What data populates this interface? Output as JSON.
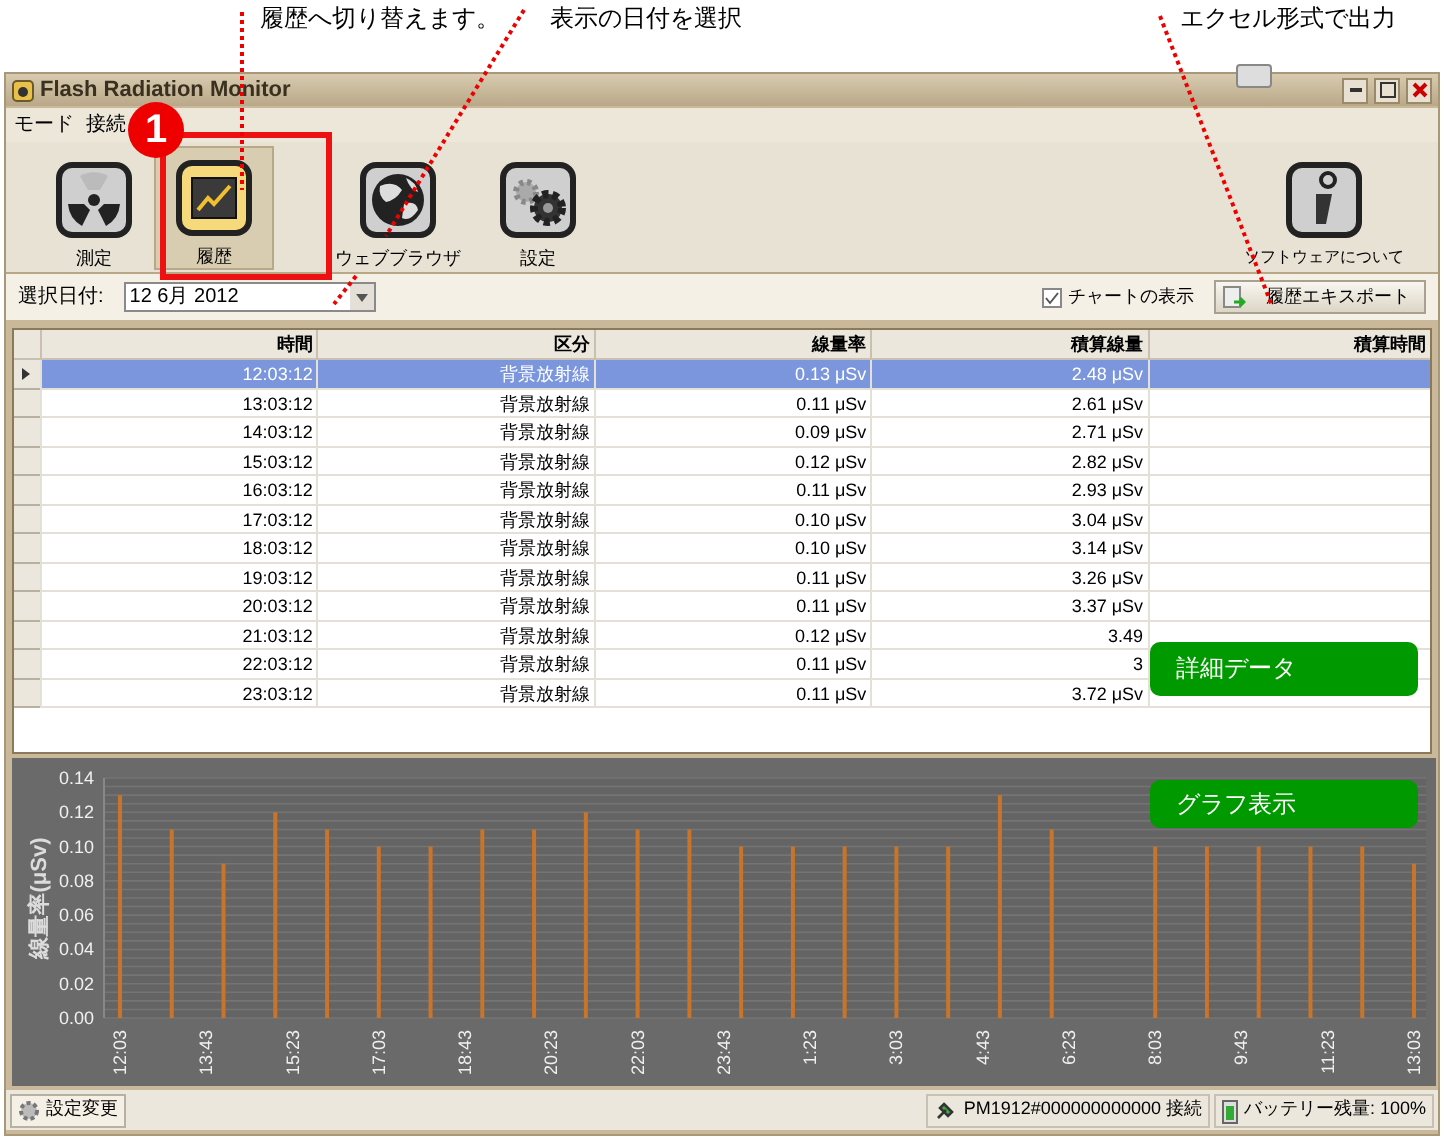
{
  "annotations": [
    {
      "text": "履歴へ切り替えます。"
    },
    {
      "text": "表示の日付を選択"
    },
    {
      "text": "エクセル形式で出力"
    }
  ],
  "callout": {
    "badge": "1"
  },
  "window": {
    "title": "Flash Radiation Monitor"
  },
  "menu": [
    {
      "label": "モード"
    },
    {
      "label": "接続"
    }
  ],
  "toolbar": [
    {
      "label": "測定",
      "kind": "radiation",
      "selected": false
    },
    {
      "label": "履歴",
      "kind": "history",
      "selected": true
    },
    {
      "label": "ウェブブラウザ",
      "kind": "globe",
      "selected": false
    },
    {
      "label": "設定",
      "kind": "gears",
      "selected": false
    },
    {
      "label": "ソフトウェアについて",
      "kind": "info",
      "selected": false
    }
  ],
  "date_row": {
    "label": "選択日付:",
    "value": "12 6月 2012",
    "show_chart": {
      "label": "チャートの表示",
      "checked": true
    },
    "export_button": "履歴エキスポート"
  },
  "table": {
    "columns": [
      "時間",
      "区分",
      "線量率",
      "積算線量",
      "積算時間"
    ],
    "rows": [
      {
        "cells": [
          "12:03:12",
          "背景放射線",
          "0.13 μSv",
          "2.48 μSv"
        ],
        "selected": true
      },
      {
        "cells": [
          "13:03:12",
          "背景放射線",
          "0.11 μSv",
          "2.61 μSv"
        ],
        "selected": false
      },
      {
        "cells": [
          "14:03:12",
          "背景放射線",
          "0.09 μSv",
          "2.71 μSv"
        ],
        "selected": false
      },
      {
        "cells": [
          "15:03:12",
          "背景放射線",
          "0.12 μSv",
          "2.82 μSv"
        ],
        "selected": false
      },
      {
        "cells": [
          "16:03:12",
          "背景放射線",
          "0.11 μSv",
          "2.93 μSv"
        ],
        "selected": false
      },
      {
        "cells": [
          "17:03:12",
          "背景放射線",
          "0.10 μSv",
          "3.04 μSv"
        ],
        "selected": false
      },
      {
        "cells": [
          "18:03:12",
          "背景放射線",
          "0.10 μSv",
          "3.14 μSv"
        ],
        "selected": false
      },
      {
        "cells": [
          "19:03:12",
          "背景放射線",
          "0.11 μSv",
          "3.26 μSv"
        ],
        "selected": false
      },
      {
        "cells": [
          "20:03:12",
          "背景放射線",
          "0.11 μSv",
          "3.37 μSv"
        ],
        "selected": false
      },
      {
        "cells": [
          "21:03:12",
          "背景放射線",
          "0.12 μSv",
          "3.49"
        ],
        "selected": false
      },
      {
        "cells": [
          "22:03:12",
          "背景放射線",
          "0.11 μSv",
          "3"
        ],
        "selected": false
      },
      {
        "cells": [
          "23:03:12",
          "背景放射線",
          "0.11 μSv",
          "3.72 μSv"
        ],
        "selected": false
      }
    ]
  },
  "overlay_labels": [
    {
      "text": "詳細データ"
    },
    {
      "text": "グラフ表示"
    }
  ],
  "chart": {
    "chart_data": {
      "type": "bar",
      "ylabel": "線量率(μSv)",
      "categories": [
        "12:03",
        null,
        null,
        null,
        null,
        "13:43",
        null,
        null,
        null,
        null,
        "15:23",
        null,
        null,
        null,
        null,
        "17:03",
        null,
        null,
        null,
        null,
        "18:43",
        null,
        null,
        null,
        null,
        "20:23",
        null,
        null,
        null,
        null,
        "22:03",
        null,
        null,
        null,
        null,
        "23:43",
        null,
        null,
        null,
        null,
        "1:23",
        null,
        null,
        null,
        null,
        "3:03",
        null,
        null,
        null,
        null,
        "4:43",
        null,
        null,
        null,
        null,
        "6:23",
        null,
        null,
        null,
        null,
        "8:03",
        null,
        null,
        null,
        null,
        "9:43",
        null,
        null,
        null,
        null,
        "11:23",
        null,
        null,
        null,
        null,
        "13:03"
      ],
      "series": [
        {
          "color": "#c8742a",
          "values": [
            0.13,
            null,
            null,
            0.11,
            null,
            null,
            0.09,
            null,
            null,
            0.12,
            null,
            null,
            0.11,
            null,
            null,
            0.1,
            null,
            null,
            0.1,
            null,
            null,
            0.11,
            null,
            null,
            0.11,
            null,
            null,
            0.12,
            null,
            null,
            0.11,
            null,
            null,
            0.11,
            null,
            null,
            0.1,
            null,
            null,
            0.1,
            null,
            null,
            0.1,
            null,
            null,
            0.1,
            null,
            null,
            0.1,
            null,
            null,
            0.13,
            null,
            null,
            0.11,
            null,
            null,
            null,
            null,
            null,
            0.1,
            null,
            null,
            0.1,
            null,
            null,
            0.1,
            null,
            null,
            0.1,
            null,
            null,
            0.1,
            null,
            null,
            0.09
          ]
        }
      ],
      "ylim": [
        0,
        0.14
      ],
      "yticks": [
        {
          "value": 0,
          "label": "0.00"
        },
        {
          "value": 0.02,
          "label": "0.02"
        },
        {
          "value": 0.04,
          "label": "0.04"
        },
        {
          "value": 0.06,
          "label": "0.06"
        },
        {
          "value": 0.08,
          "label": "0.08"
        },
        {
          "value": 0.1,
          "label": "0.10"
        },
        {
          "value": 0.12,
          "label": "0.12"
        },
        {
          "value": 0.14,
          "label": "0.14"
        }
      ],
      "grid": true
    }
  },
  "status_bar": {
    "settings_button": "設定変更",
    "connection": "PM1912#000000000000 接続",
    "battery": "バッテリー残量: 100%"
  }
}
